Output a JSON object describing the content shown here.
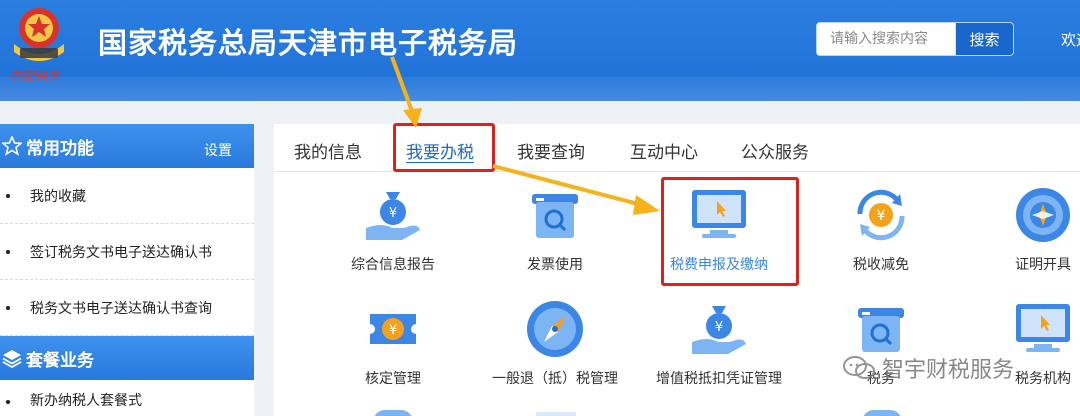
{
  "header": {
    "title": "国家税务总局天津市电子税务局",
    "emblem_sign": "中国税务",
    "search_placeholder": "请输入搜索内容",
    "search_label": "搜索",
    "welcome": "欢迎"
  },
  "sidebar": {
    "section1": {
      "title": "常用功能",
      "link": "设置"
    },
    "items1": [
      "我的收藏",
      "签订税务文书电子送达确认书",
      "税务文书电子送达确认书查询"
    ],
    "section2": {
      "title": "套餐业务"
    },
    "items2": [
      "新办纳税人套餐式"
    ]
  },
  "tabs": [
    "我的信息",
    "我要办税",
    "我要查询",
    "互动中心",
    "公众服务"
  ],
  "active_tab": "我要办税",
  "services": [
    {
      "label": "综合信息报告",
      "icon": "money-bag-hand-icon"
    },
    {
      "label": "发票使用",
      "icon": "invoice-search-icon"
    },
    {
      "label": "税费申报及缴纳",
      "icon": "monitor-cursor-icon"
    },
    {
      "label": "税收减免",
      "icon": "yuan-cycle-icon"
    },
    {
      "label": "证明开具",
      "icon": "globe-icon"
    },
    {
      "label": "核定管理",
      "icon": "yuan-ticket-icon"
    },
    {
      "label": "一般退（抵）税管理",
      "icon": "compass-icon"
    },
    {
      "label": "增值税抵扣凭证管理",
      "icon": "money-bag-hand-icon"
    },
    {
      "label": "税务",
      "icon": "invoice-search-icon"
    },
    {
      "label": "税务机构",
      "icon": "monitor-cursor-icon"
    }
  ],
  "watermark": "智宇财税服务",
  "colors": {
    "primary": "#1a66cf",
    "header": "#2277dc",
    "highlight": "#e0201a",
    "arrow": "#f5b21a"
  }
}
